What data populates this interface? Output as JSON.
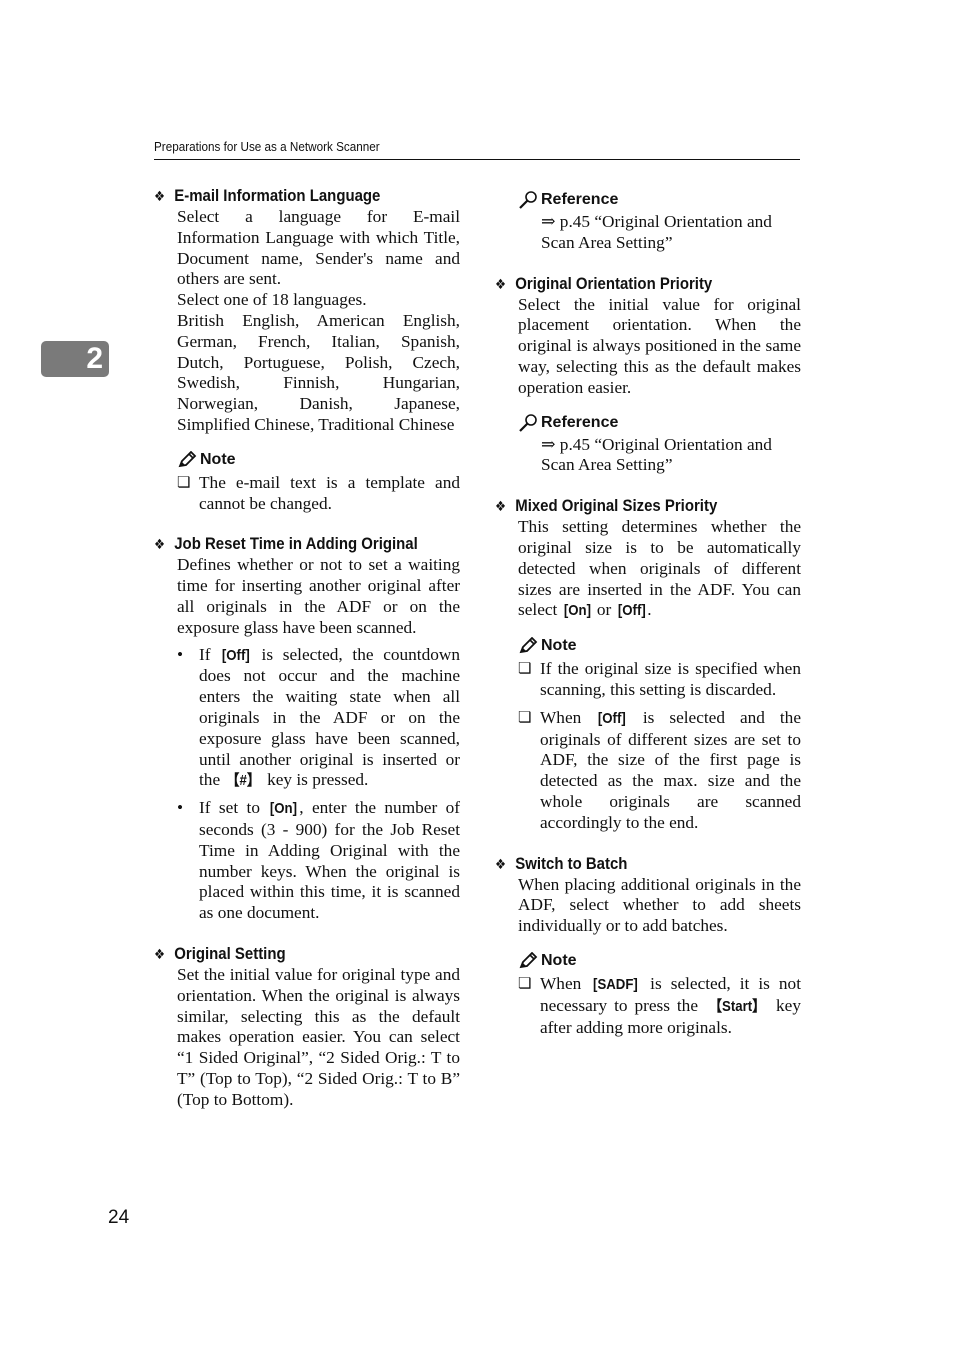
{
  "header": {
    "title": "Preparations for Use as a Network Scanner"
  },
  "chapter_tab": {
    "number": "2"
  },
  "page_number": "24",
  "left_column": {
    "email_language": {
      "title": "E-mail Information Language",
      "paragraphs": [
        "Select a language for E-mail Information Language with which Title, Document name, Sender's name and others are sent.",
        "Select one of 18 languages.",
        "British English, American English, German, French, Italian, Spanish, Dutch, Portuguese, Polish, Czech, Swedish, Finnish, Hungarian, Norwegian, Danish, Japanese, Simplified Chinese, Traditional Chinese"
      ],
      "note": {
        "label": "Note",
        "items": [
          "The e-mail text is a template and cannot be changed."
        ]
      }
    },
    "job_reset": {
      "title": "Job Reset Time in Adding Original",
      "paragraph": "Defines whether or not to set a waiting time for inserting another original after all originals in the ADF or on the exposure glass have been scanned.",
      "bullet1": {
        "pre": "If ",
        "key": "[Off]",
        "post": " is selected, the countdown does not occur and the machine enters the waiting state when all originals in the ADF or on the exposure glass have been scanned, until another original is inserted or the ",
        "hw_key": "【#】",
        "end": " key is pressed."
      },
      "bullet2": {
        "pre": "If set to ",
        "key": "[On]",
        "post": ", enter the number of seconds (3 - 900) for the Job Reset Time in Adding Original with the number keys. When the original is placed within this time, it is scanned as one document."
      }
    },
    "original_setting": {
      "title": "Original Setting",
      "paragraph": "Set the initial value for original type and orientation. When the original is always similar, selecting this as the default makes operation easier. You can select “1 Sided Original”, “2 Sided Orig.: T to T” (Top to Top), “2 Sided Orig.: T to B” (Top to Bottom)."
    }
  },
  "right_column": {
    "reference1": {
      "label": "Reference",
      "text": "⇒ p.45 “Original Orientation and Scan Area Setting”"
    },
    "orientation_priority": {
      "title": "Original Orientation Priority",
      "paragraph": "Select the initial value for original placement orientation. When the original is always positioned in the same way, selecting this as the default makes operation easier.",
      "reference": {
        "label": "Reference",
        "text": "⇒ p.45 “Original Orientation and Scan Area Setting”"
      }
    },
    "mixed_sizes": {
      "title": "Mixed Original Sizes Priority",
      "paragraph_pre": "This setting determines whether the original size is to be automatically detected when originals of different sizes are inserted in the ADF. You can select ",
      "key_on": "[On]",
      "mid": " or ",
      "key_off": "[Off]",
      "end": ".",
      "note": {
        "label": "Note",
        "item1": "If the original size is specified when scanning, this setting is discarded.",
        "item2_pre": "When ",
        "item2_key": "[Off]",
        "item2_post": " is selected and the originals of different sizes are set to ADF, the size of the first page is detected as the max. size and the whole originals are scanned accordingly to the end."
      }
    },
    "switch_batch": {
      "title": "Switch to Batch",
      "paragraph": "When placing additional originals in the ADF, select whether to add sheets individually or to add batches.",
      "note": {
        "label": "Note",
        "item_pre": "When ",
        "item_key": "[SADF]",
        "item_mid": " is selected, it is not necessary to press the ",
        "item_hw_key": "【Start】",
        "item_post": " key after adding more originals."
      }
    }
  },
  "icons": {
    "section_marker": "❖",
    "note_item_marker": "❏",
    "bullet": "•"
  }
}
